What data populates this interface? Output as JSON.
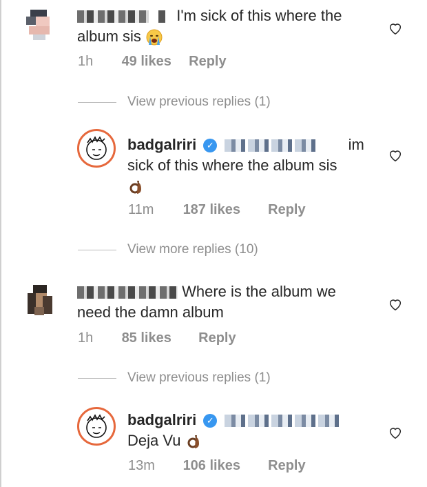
{
  "comments": [
    {
      "username": "",
      "text": "I'm sick of this where the album sis",
      "text_line1": "I'm sick of this where the",
      "text_line2": "album sis",
      "time": "1h",
      "likes": "49 likes",
      "reply": "Reply",
      "view_replies": "View previous replies (1)"
    },
    {
      "username": "badgalriri",
      "verified": true,
      "text_line1_suffix": "im",
      "text_line2": "sick of this where the album sis",
      "time": "11m",
      "likes": "187 likes",
      "reply": "Reply",
      "view_replies": "View more replies (10)"
    },
    {
      "username": "",
      "text_line1": "Where is the album we",
      "text_line2": "need the damn album",
      "time": "1h",
      "likes": "85 likes",
      "reply": "Reply",
      "view_replies": "View previous replies (1)"
    },
    {
      "username": "badgalriri",
      "verified": true,
      "text_line2": "Deja Vu",
      "time": "13m",
      "likes": "106 likes",
      "reply": "Reply"
    }
  ],
  "icons": {
    "heart": "heart-outline-icon",
    "verified": "verified-badge-icon",
    "crying_emoji": "loudly-crying-face-emoji",
    "ok_hand_emoji": "ok-hand-emoji"
  },
  "colors": {
    "text": "#262626",
    "meta": "#8e8e8e",
    "verified": "#3897f0"
  }
}
